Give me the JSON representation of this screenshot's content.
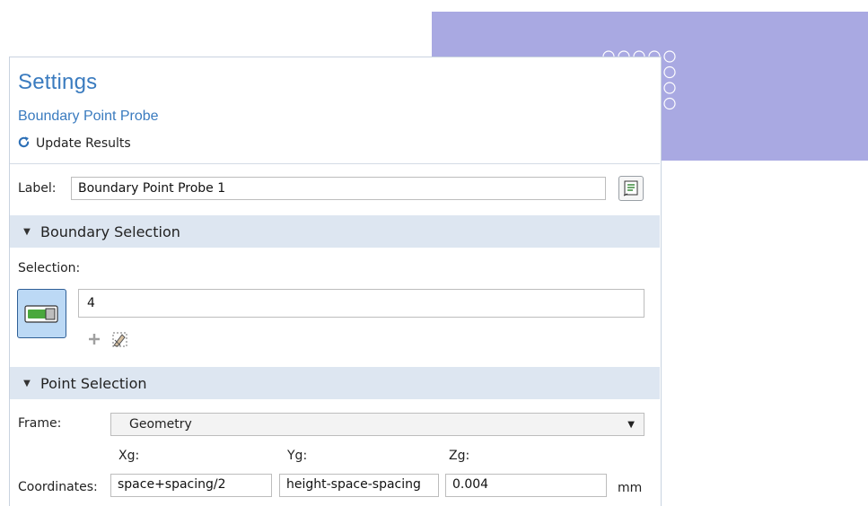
{
  "settings": {
    "title": "Settings",
    "subtitle": "Boundary Point Probe",
    "update_label": "Update Results",
    "accent_color": "#3a7bbf"
  },
  "label_row": {
    "label": "Label:",
    "value": "Boundary Point Probe 1"
  },
  "boundary_section": {
    "header": "Boundary Selection",
    "selection_label": "Selection:",
    "selection_value": "4",
    "icons": [
      "toggle-active-icon",
      "add-icon",
      "clear-selection-icon"
    ]
  },
  "point_section": {
    "header": "Point Selection",
    "frame_label": "Frame:",
    "frame_value": "Geometry",
    "columns": [
      "Xg:",
      "Yg:",
      "Zg:"
    ],
    "coordinates_label": "Coordinates:",
    "coordinates": [
      "space+spacing/2",
      "height-space-spacing",
      "0.004"
    ],
    "unit": "mm"
  },
  "graphics": {
    "background_color": "#a9a9e2",
    "grid_rows": 4,
    "grid_cols": 5,
    "highlight_color": "#e8141e"
  }
}
